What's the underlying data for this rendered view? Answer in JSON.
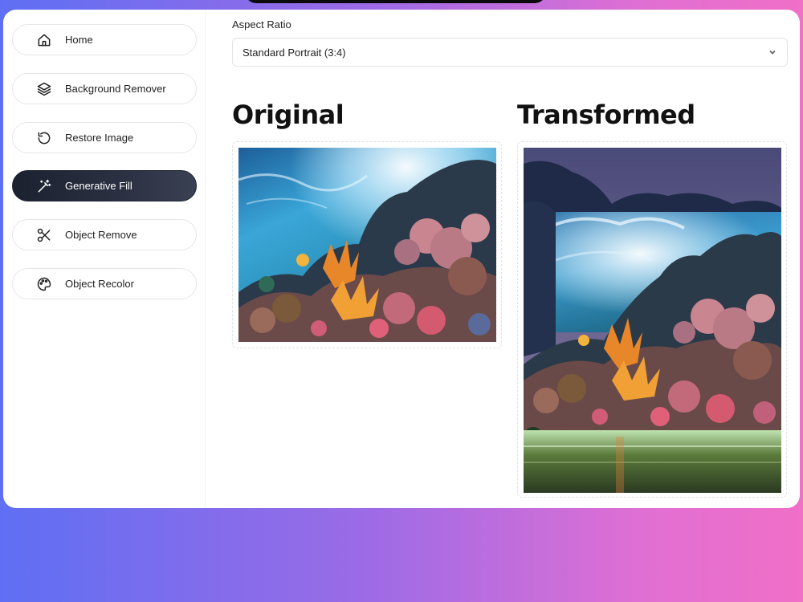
{
  "sidebar": {
    "items": [
      {
        "label": "Home",
        "icon": "home-icon",
        "active": false
      },
      {
        "label": "Background Remover",
        "icon": "layers-icon",
        "active": false
      },
      {
        "label": "Restore Image",
        "icon": "restore-icon",
        "active": false
      },
      {
        "label": "Generative Fill",
        "icon": "magic-wand-icon",
        "active": true
      },
      {
        "label": "Object Remove",
        "icon": "scissors-icon",
        "active": false
      },
      {
        "label": "Object Recolor",
        "icon": "palette-icon",
        "active": false
      }
    ]
  },
  "form": {
    "aspect_label": "Aspect Ratio",
    "aspect_value": "Standard Portrait (3:4)"
  },
  "results": {
    "original_title": "Original",
    "transformed_title": "Transformed"
  },
  "colors": {
    "active_nav": "#1c2130",
    "background_gradient_start": "#5f6ff3",
    "background_gradient_end": "#f06fc7"
  }
}
